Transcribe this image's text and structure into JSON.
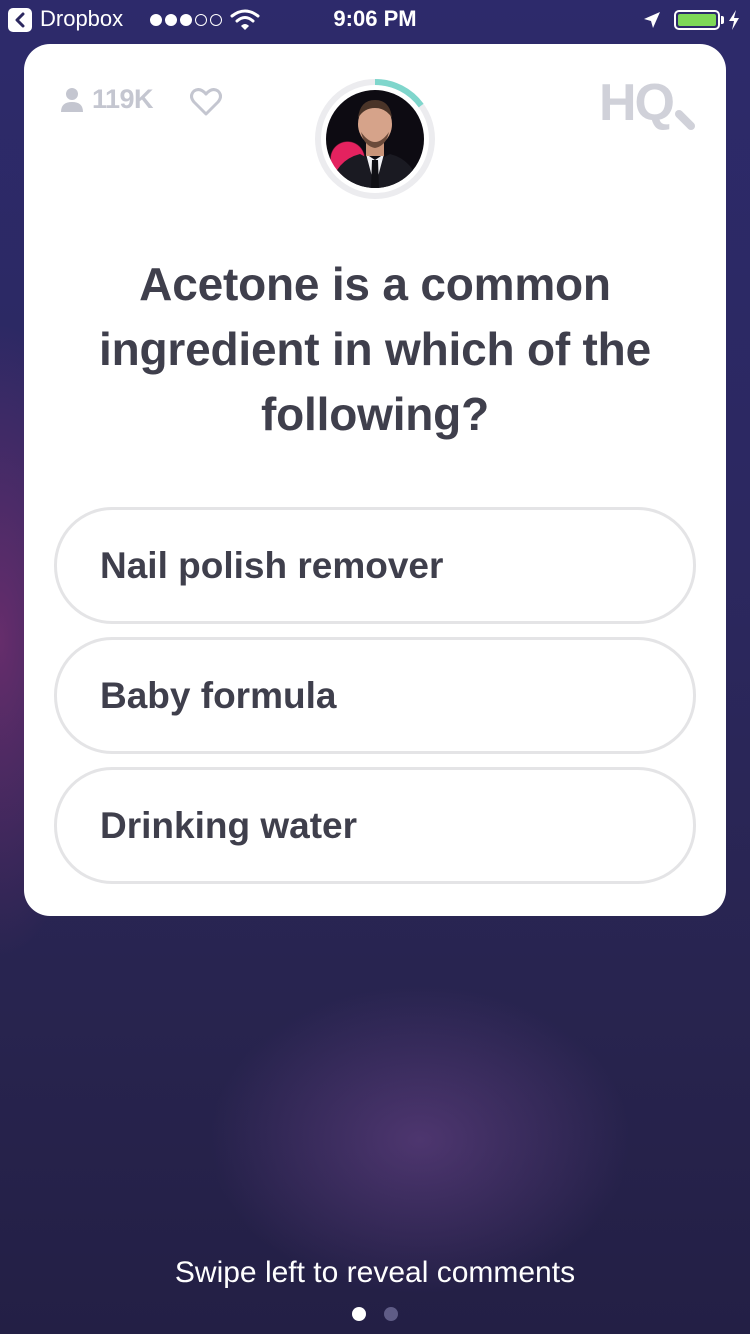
{
  "status_bar": {
    "back_app": "Dropbox",
    "time": "9:06 PM",
    "signal_bars_filled": 3,
    "signal_bars_total": 5,
    "battery_level": 1.0,
    "icons": [
      "back-icon",
      "wifi-icon",
      "location-arrow-icon",
      "battery-icon",
      "charging-bolt-icon"
    ]
  },
  "card": {
    "viewer_count": "119K",
    "logo_text": "HQ",
    "question": "Acetone is a common ingredient in which of the following?",
    "answers": [
      {
        "label": "Nail polish remover"
      },
      {
        "label": "Baby formula"
      },
      {
        "label": "Drinking water"
      }
    ],
    "timer_progress": 0.15,
    "icons": [
      "user-icon",
      "heart-icon",
      "hq-logo",
      "host-avatar",
      "timer-ring"
    ]
  },
  "footer": {
    "swipe_hint": "Swipe left to reveal comments",
    "page_count": 2,
    "active_page": 1
  },
  "colors": {
    "background": "#2c2860",
    "card": "#ffffff",
    "text_dark": "#3f3f4c",
    "muted": "#c4c6d0",
    "timer_accent": "#7fd6cc",
    "battery": "#7ed957"
  }
}
